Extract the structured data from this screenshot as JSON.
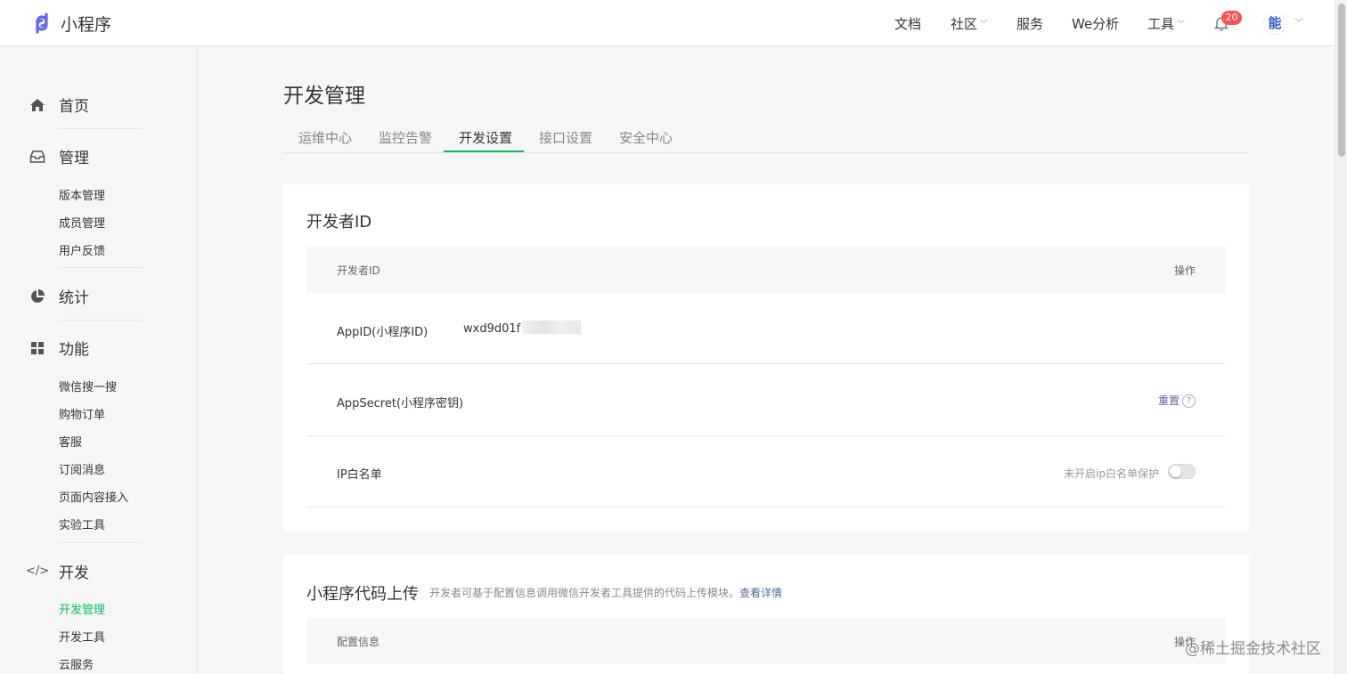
{
  "header": {
    "logo_text": "小程序",
    "nav": [
      {
        "label": "文档",
        "has_dropdown": false
      },
      {
        "label": "社区",
        "has_dropdown": true
      },
      {
        "label": "服务",
        "has_dropdown": false
      },
      {
        "label": "We分析",
        "has_dropdown": false
      },
      {
        "label": "工具",
        "has_dropdown": true
      }
    ],
    "notification_count": "20",
    "avatar_text": "能"
  },
  "sidebar": {
    "groups": [
      {
        "label": "首页",
        "icon": "home-icon"
      },
      {
        "label": "管理",
        "icon": "inbox-icon",
        "items": [
          "版本管理",
          "成员管理",
          "用户反馈"
        ]
      },
      {
        "label": "统计",
        "icon": "pie-chart-icon"
      },
      {
        "label": "功能",
        "icon": "grid-icon",
        "items": [
          "微信搜一搜",
          "购物订单",
          "客服",
          "订阅消息",
          "页面内容接入",
          "实验工具"
        ]
      },
      {
        "label": "开发",
        "icon": "code-icon",
        "items": [
          "开发管理",
          "开发工具",
          "云服务"
        ]
      }
    ],
    "active_item": "开发管理"
  },
  "main": {
    "page_title": "开发管理",
    "tabs": [
      "运维中心",
      "监控告警",
      "开发设置",
      "接口设置",
      "安全中心"
    ],
    "active_tab": "开发设置",
    "developer_id_card": {
      "title": "开发者ID",
      "col_name": "开发者ID",
      "col_action": "操作",
      "appid_label": "AppID(小程序ID)",
      "appid_value": "wxd9d01f",
      "appsecret_label": "AppSecret(小程序密钥)",
      "reset_label": "重置",
      "ip_whitelist_label": "IP白名单",
      "ip_whitelist_status": "未开启ip白名单保护"
    },
    "upload_card": {
      "title": "小程序代码上传",
      "description": "开发者可基于配置信息调用微信开发者工具提供的代码上传模块。",
      "details_link": "查看详情",
      "col_config": "配置信息",
      "col_action": "操作"
    }
  },
  "watermark": "@稀土掘金技术社区",
  "colors": {
    "accent": "#07c160",
    "link": "#576b95",
    "badge": "#fa5151"
  }
}
